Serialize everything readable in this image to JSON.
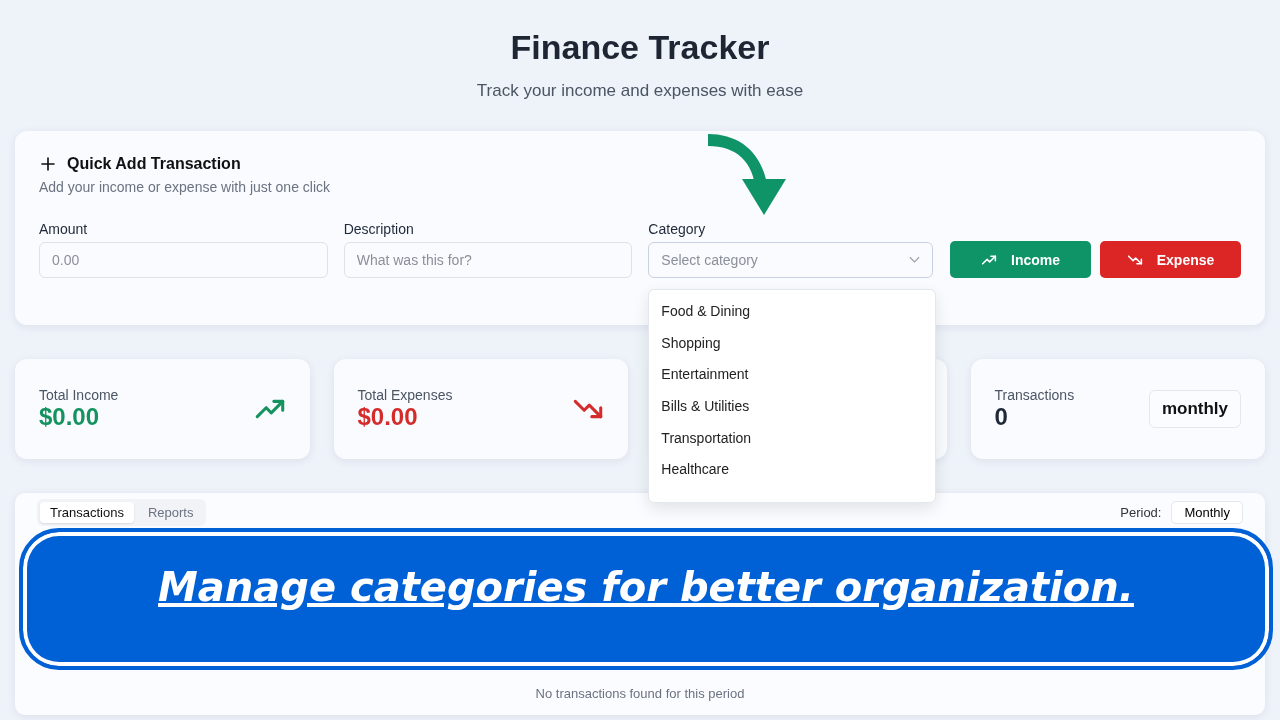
{
  "header": {
    "title": "Finance Tracker",
    "subtitle": "Track your income and expenses with ease"
  },
  "quick_add": {
    "title": "Quick Add Transaction",
    "subtitle": "Add your income or expense with just one click",
    "fields": [
      {
        "kind": "input",
        "label": "Amount",
        "placeholder": "0.00"
      },
      {
        "kind": "input",
        "label": "Description",
        "placeholder": "What was this for?"
      },
      {
        "kind": "select",
        "label": "Category",
        "placeholder": "Select category",
        "expanded": true,
        "options": [
          "Food & Dining",
          "Shopping",
          "Entertainment",
          "Bills & Utilities",
          "Transportation",
          "Healthcare"
        ]
      }
    ],
    "buttons": [
      {
        "kind": "income",
        "label": "Income"
      },
      {
        "kind": "expense",
        "label": "Expense"
      }
    ]
  },
  "stats": [
    {
      "kind": "income",
      "label": "Total Income",
      "value": "$0.00"
    },
    {
      "kind": "expense",
      "label": "Total Expenses",
      "value": "$0.00"
    },
    {
      "kind": "hidden"
    },
    {
      "kind": "count",
      "label": "Transactions",
      "value": "0",
      "badge": "monthly"
    }
  ],
  "panel": {
    "tabs": [
      {
        "label": "Transactions",
        "selected": true
      },
      {
        "label": "Reports",
        "selected": false
      }
    ],
    "period_label": "Period:",
    "period_value": "Monthly",
    "empty_text": "No transactions found for this period"
  },
  "caption": "Manage categories for better organization."
}
